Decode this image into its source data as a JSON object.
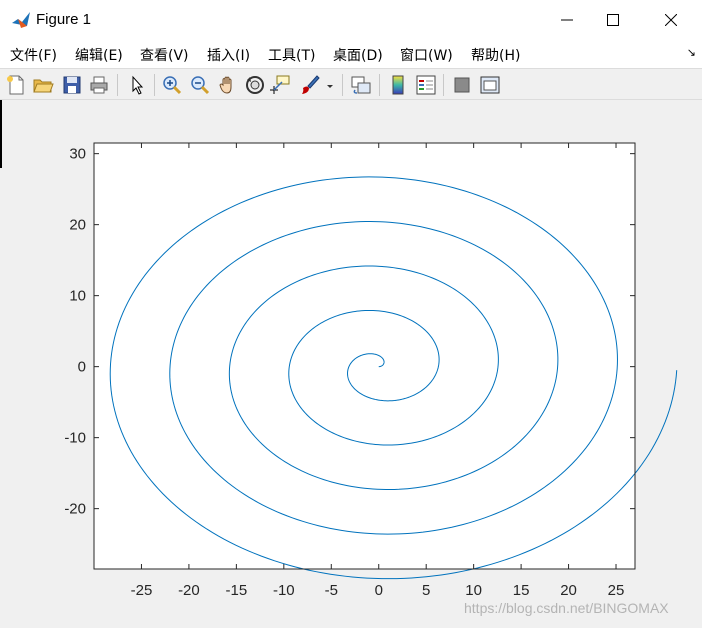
{
  "window": {
    "title": "Figure 1"
  },
  "menubar": {
    "items": [
      {
        "label": "文件(F)",
        "id": "menu-file"
      },
      {
        "label": "编辑(E)",
        "id": "menu-edit"
      },
      {
        "label": "查看(V)",
        "id": "menu-view"
      },
      {
        "label": "插入(I)",
        "id": "menu-insert"
      },
      {
        "label": "工具(T)",
        "id": "menu-tools"
      },
      {
        "label": "桌面(D)",
        "id": "menu-desktop"
      },
      {
        "label": "窗口(W)",
        "id": "menu-window"
      },
      {
        "label": "帮助(H)",
        "id": "menu-help"
      }
    ]
  },
  "toolbar": {
    "icons": [
      "new-figure-icon",
      "open-file-icon",
      "save-icon",
      "print-icon",
      "pointer-icon",
      "zoom-in-icon",
      "zoom-out-icon",
      "pan-hand-icon",
      "rotate-3d-icon",
      "data-cursor-icon",
      "brush-icon",
      "dropdown-arrow-icon",
      "link-plot-icon",
      "colorbar-icon",
      "legend-icon",
      "hide-plot-tools-icon",
      "show-plot-tools-icon"
    ]
  },
  "colors": {
    "line": "#0072bd",
    "axes": "#262626",
    "background": "#f0f0f0"
  },
  "watermark": "https://blog.csdn.net/BINGOMAX",
  "chart_data": {
    "type": "line",
    "title": "",
    "xlabel": "",
    "ylabel": "",
    "xlim": [
      -30,
      27
    ],
    "ylim": [
      -28.5,
      31.5
    ],
    "xticks": [
      -25,
      -20,
      -15,
      -10,
      -5,
      0,
      5,
      10,
      15,
      20,
      25
    ],
    "yticks": [
      -20,
      -10,
      0,
      10,
      20,
      30
    ],
    "xtick_labels": [
      "-25",
      "-20",
      "-15",
      "-10",
      "-5",
      "0",
      "5",
      "10",
      "15",
      "20",
      "25"
    ],
    "ytick_labels": [
      "-20",
      "-10",
      "0",
      "10",
      "20",
      "30"
    ],
    "grid": false,
    "series": [
      {
        "equation": "x = t·cos(t), y = t·sin(t)",
        "t_range": [
          0,
          31.4
        ]
      }
    ]
  }
}
